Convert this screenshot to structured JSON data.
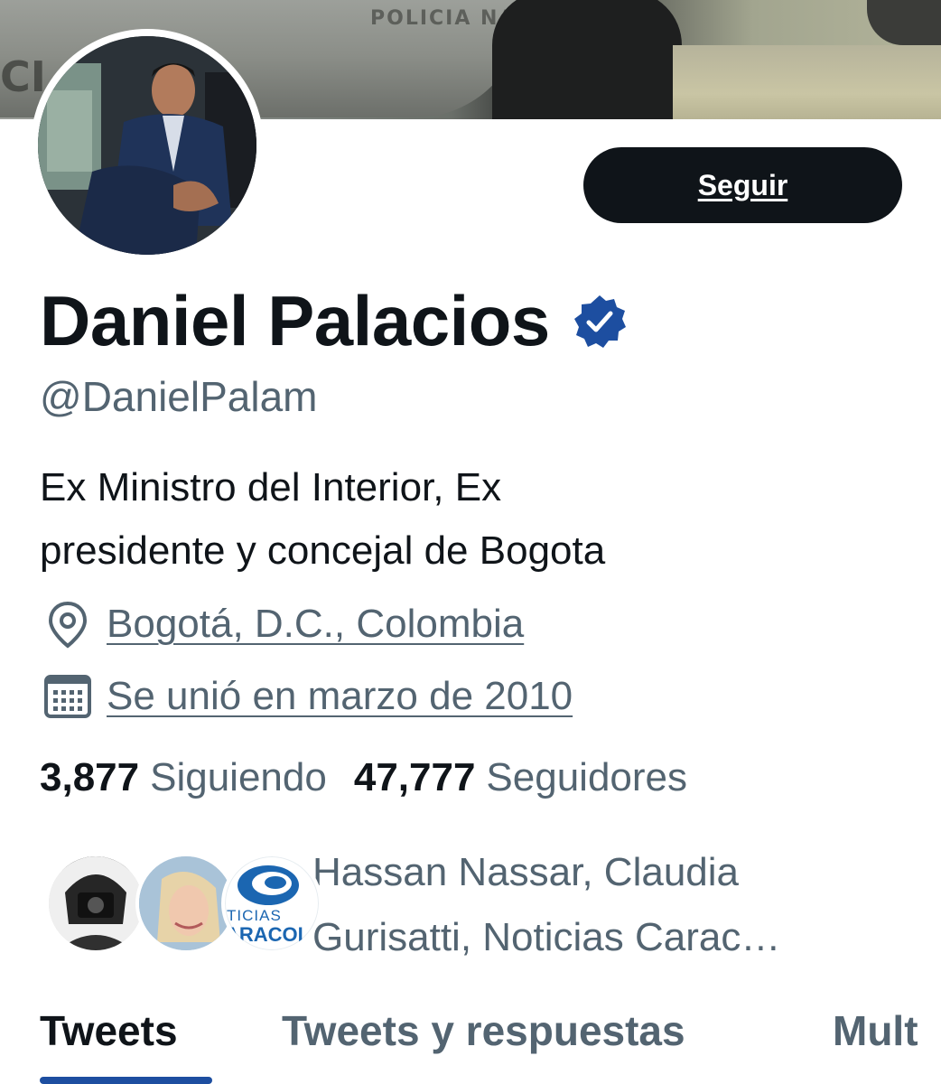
{
  "banner": {
    "text_top": "POLICIA NA",
    "text_left": "CI"
  },
  "profile": {
    "follow_label": "Seguir",
    "name": "Daniel Palacios",
    "handle": "@DanielPalam",
    "bio_line1": "Ex Ministro del Interior, Ex",
    "bio_line2": "presidente y concejal de Bogota",
    "location": "Bogotá, D.C., Colombia",
    "joined": "Se unió en marzo de 2010"
  },
  "stats": {
    "following_count": "3,877",
    "following_label": "Siguiendo",
    "followers_count": "47,777",
    "followers_label": "Seguidores"
  },
  "followed_by": {
    "line1": "Hassan Nassar, Claudia",
    "line2": "Gurisatti, Noticias Carac…",
    "logo_top": "TICIAS",
    "logo_bottom": "ARACOL"
  },
  "tabs": [
    {
      "label": "Tweets"
    },
    {
      "label": "Tweets y respuestas"
    },
    {
      "label": "Mult"
    }
  ],
  "colors": {
    "text_primary": "#0f1419",
    "text_secondary": "#536471",
    "verified_badge": "#1d4ea0",
    "tab_indicator": "#1d4ea0",
    "button_bg": "#0f1419"
  }
}
